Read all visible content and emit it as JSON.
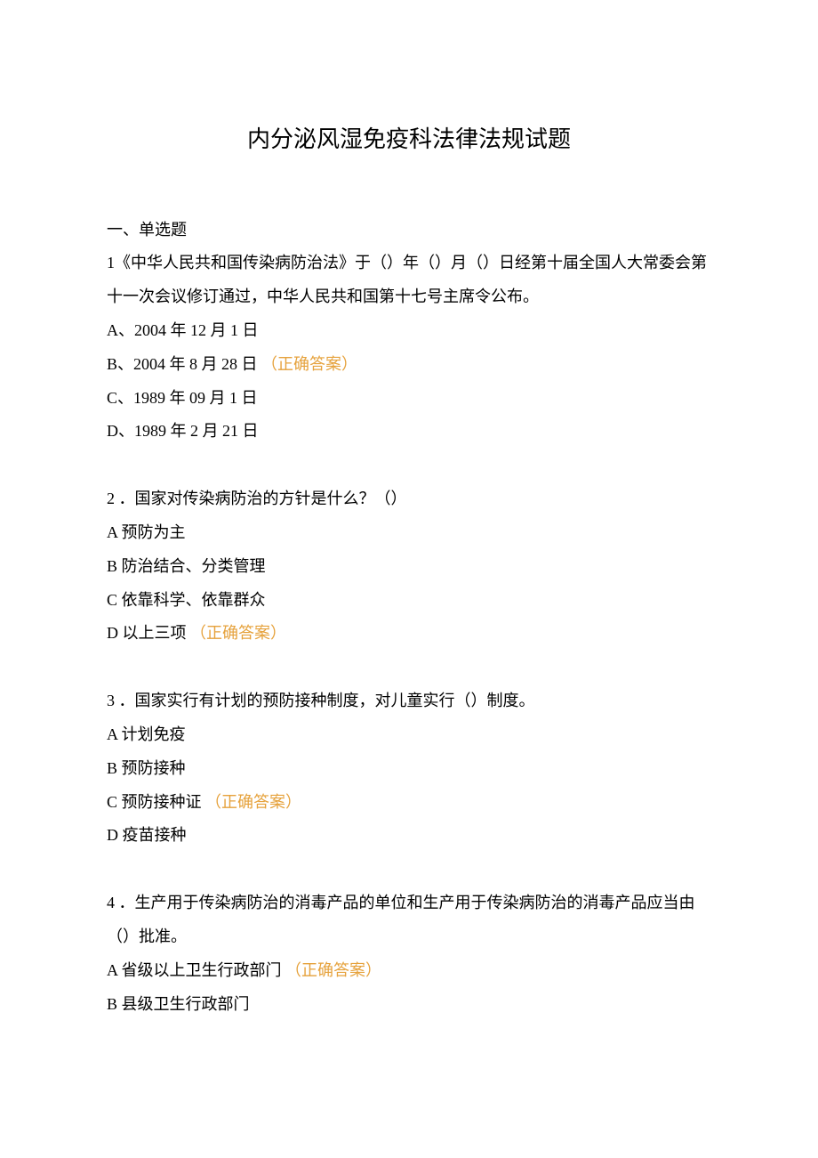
{
  "title": "内分泌风湿免疫科法律法规试题",
  "section_heading": "一、单选题",
  "q1": {
    "stem_part1": "1《中华人民共和国传染病防治法》于（）年（）月（）日经第十届全国人大常委会第十一次会议修订通过，中华人民共和国第十七号主席令公布。",
    "optA": "A、2004 年 12 月 1 日",
    "optB_text": "B、2004 年 8 月 28 日",
    "optB_ans": "（正确答案）",
    "optC": "C、1989 年 09 月 1 日",
    "optD": "D、1989 年 2 月 21 日"
  },
  "q2": {
    "stem": "2 ．国家对传染病防治的方针是什么？（）",
    "optA": "A 预防为主",
    "optB": "B 防治结合、分类管理",
    "optC": "C 依靠科学、依靠群众",
    "optD_text": "D 以上三项",
    "optD_ans": "（正确答案）"
  },
  "q3": {
    "stem": "3 ．国家实行有计划的预防接种制度，对儿童实行（）制度。",
    "optA": "A 计划免疫",
    "optB": "B 预防接种",
    "optC_text": "C 预防接种证",
    "optC_ans": "（正确答案）",
    "optD": "D 疫苗接种"
  },
  "q4": {
    "stem": "4 ．生产用于传染病防治的消毒产品的单位和生产用于传染病防治的消毒产品应当由（）批准。",
    "optA_text": "A 省级以上卫生行政部门",
    "optA_ans": "（正确答案）",
    "optB": "B 县级卫生行政部门"
  }
}
